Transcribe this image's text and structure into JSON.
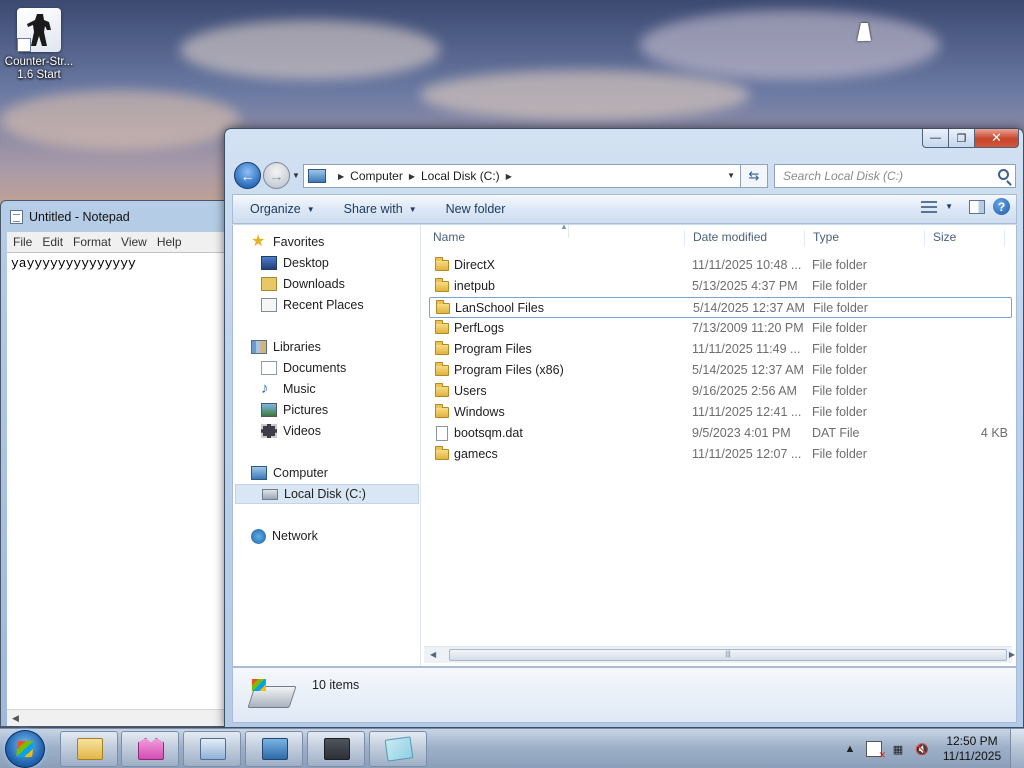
{
  "desktop": {
    "icons": [
      {
        "label_line1": "Counter-Str...",
        "label_line2": "1.6 Start",
        "icon": "counter-strike-icon"
      }
    ]
  },
  "notepad": {
    "title": "Untitled - Notepad",
    "menu": [
      "File",
      "Edit",
      "Format",
      "View",
      "Help"
    ],
    "text": "yayyyyyyyyyyyyyy"
  },
  "explorer": {
    "controls": {
      "minimize": "—",
      "maximize": "❐",
      "close": "✕"
    },
    "breadcrumb": [
      "Computer",
      "Local Disk (C:)"
    ],
    "search_placeholder": "Search Local Disk (C:)",
    "toolbar": {
      "organize": "Organize",
      "share_with": "Share with",
      "new_folder": "New folder"
    },
    "nav": {
      "favorites": "Favorites",
      "favorites_items": [
        "Desktop",
        "Downloads",
        "Recent Places"
      ],
      "libraries": "Libraries",
      "libraries_items": [
        "Documents",
        "Music",
        "Pictures",
        "Videos"
      ],
      "computer": "Computer",
      "computer_items": [
        "Local Disk (C:)"
      ],
      "network": "Network"
    },
    "columns": {
      "name": "Name",
      "date": "Date modified",
      "type": "Type",
      "size": "Size"
    },
    "files": [
      {
        "name": "DirectX",
        "date": "11/11/2025 10:48 ...",
        "type": "File folder",
        "size": "",
        "kind": "folder"
      },
      {
        "name": "inetpub",
        "date": "5/13/2025 4:37 PM",
        "type": "File folder",
        "size": "",
        "kind": "folder"
      },
      {
        "name": "LanSchool Files",
        "date": "5/14/2025 12:37 AM",
        "type": "File folder",
        "size": "",
        "kind": "folder"
      },
      {
        "name": "PerfLogs",
        "date": "7/13/2009 11:20 PM",
        "type": "File folder",
        "size": "",
        "kind": "folder"
      },
      {
        "name": "Program Files",
        "date": "11/11/2025 11:49 ...",
        "type": "File folder",
        "size": "",
        "kind": "folder"
      },
      {
        "name": "Program Files (x86)",
        "date": "5/14/2025 12:37 AM",
        "type": "File folder",
        "size": "",
        "kind": "folder"
      },
      {
        "name": "Users",
        "date": "9/16/2025 2:56 AM",
        "type": "File folder",
        "size": "",
        "kind": "folder"
      },
      {
        "name": "Windows",
        "date": "11/11/2025 12:41 ...",
        "type": "File folder",
        "size": "",
        "kind": "folder"
      },
      {
        "name": "bootsqm.dat",
        "date": "9/5/2023 4:01 PM",
        "type": "DAT File",
        "size": "4 KB",
        "kind": "file"
      },
      {
        "name": "gamecs",
        "date": "11/11/2025 12:07 ...",
        "type": "File folder",
        "size": "",
        "kind": "folder"
      }
    ],
    "status": "10 items"
  },
  "taskbar": {
    "pinned": [
      {
        "name": "taskbar-explorer-button",
        "icon": "windows-explorer-icon"
      },
      {
        "name": "taskbar-app-cat-button",
        "icon": "pink-cat-app-icon"
      },
      {
        "name": "taskbar-network-button",
        "icon": "network-app-icon"
      },
      {
        "name": "taskbar-monitor-button",
        "icon": "monitor-app-icon"
      },
      {
        "name": "taskbar-monitor2-button",
        "icon": "dark-monitor-app-icon"
      },
      {
        "name": "taskbar-notepad-button",
        "icon": "notepad-icon"
      }
    ],
    "tray": {
      "time": "12:50 PM",
      "date": "11/11/2025"
    }
  }
}
